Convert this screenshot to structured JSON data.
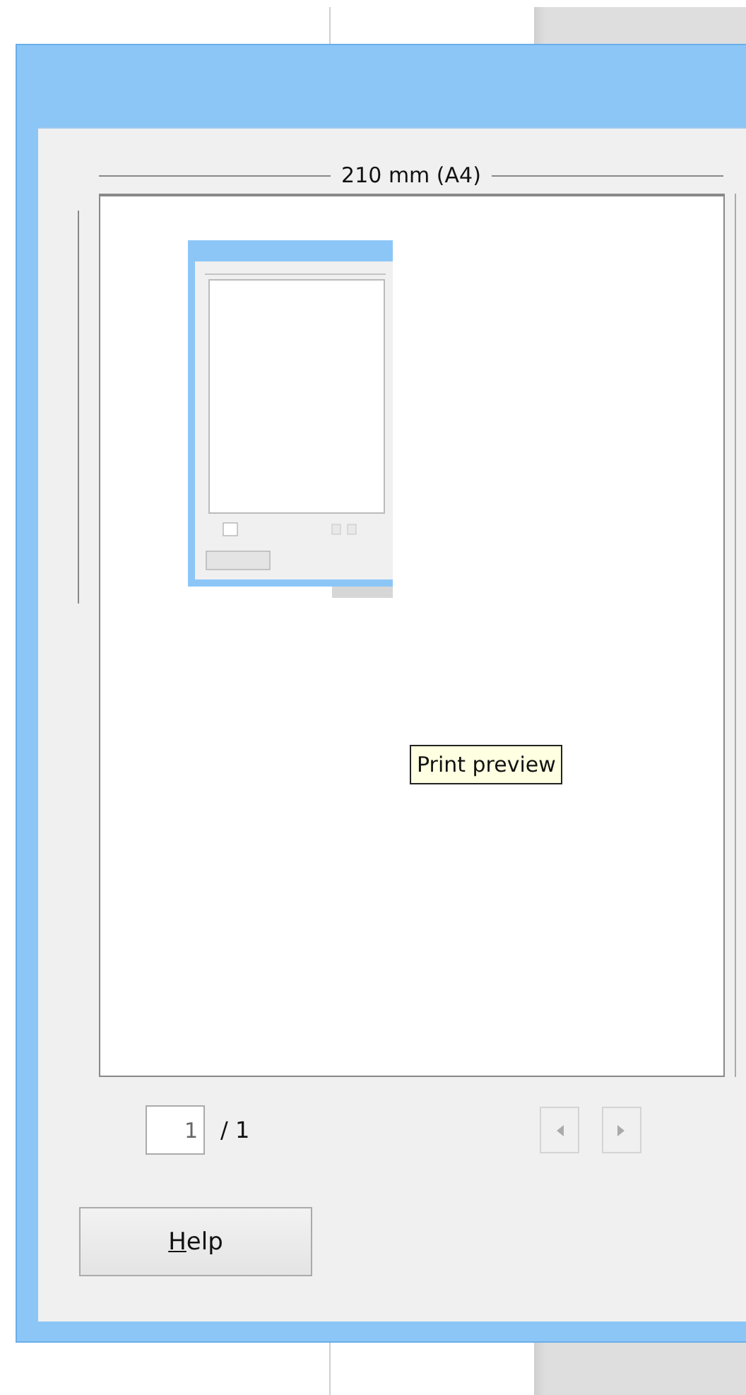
{
  "preview": {
    "width_label": "210 mm (A4)"
  },
  "tooltip": {
    "text": "Print preview"
  },
  "pager": {
    "page_value": "1",
    "page_total": "/ 1",
    "buttons": [
      {
        "kind": "previous",
        "disabled": true
      },
      {
        "kind": "next",
        "disabled": true
      }
    ]
  },
  "help_button": {
    "label": "Help"
  }
}
